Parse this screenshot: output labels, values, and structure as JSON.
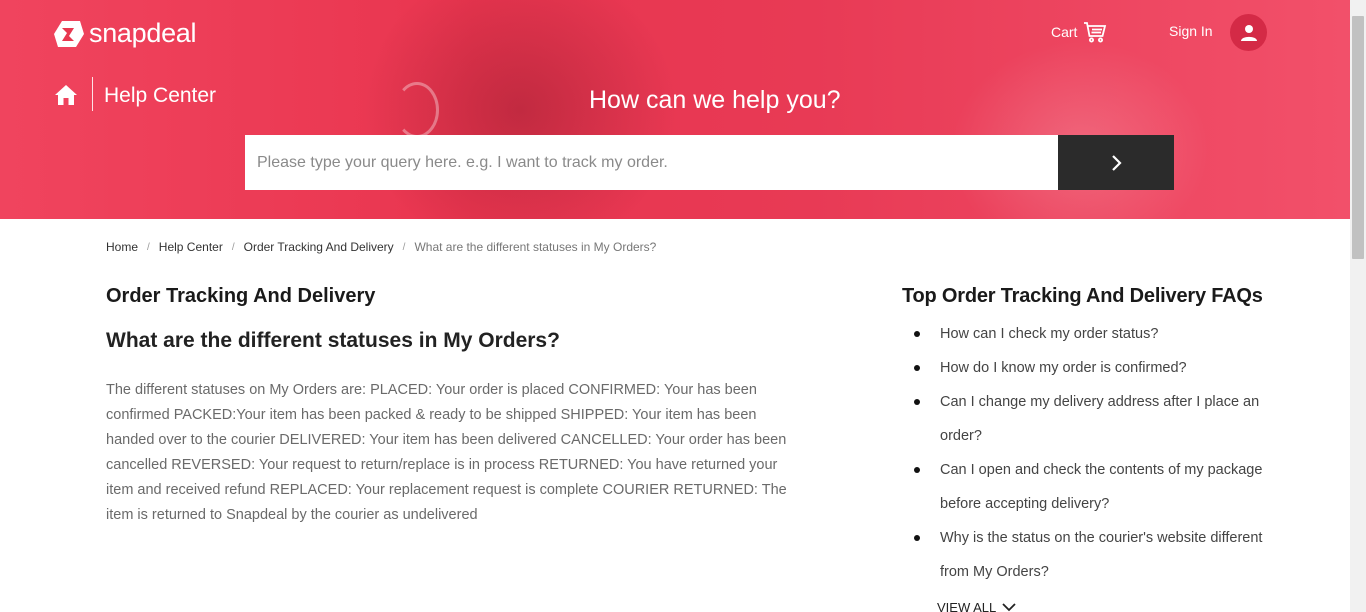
{
  "brand": {
    "name": "snapdeal"
  },
  "header": {
    "cart_label": "Cart",
    "signin_label": "Sign In",
    "help_center_title": "Help Center",
    "hero_heading": "How can we help you?"
  },
  "search": {
    "placeholder": "Please type your query here. e.g. I want to track my order."
  },
  "breadcrumb": {
    "items": [
      "Home",
      "Help Center",
      "Order Tracking And Delivery",
      "What are the different statuses in My Orders?"
    ]
  },
  "main": {
    "section_title": "Order Tracking And Delivery",
    "question_title": "What are the different statuses in My Orders?",
    "answer": "The different statuses on My Orders are: PLACED: Your order is placed CONFIRMED: Your has been confirmed PACKED:Your item has been packed & ready to be shipped SHIPPED: Your item has been handed over to the courier DELIVERED: Your item has been delivered CANCELLED: Your order has been cancelled REVERSED: Your request to return/replace is in process RETURNED: You have returned your item and received refund REPLACED: Your replacement request is complete COURIER RETURNED: The item is returned to Snapdeal by the courier as undelivered"
  },
  "sidebar": {
    "title": "Top Order Tracking And Delivery FAQs",
    "faqs": [
      "How can I check my order status?",
      "How do I know my order is confirmed?",
      "Can I change my delivery address after I place an order?",
      "Can I open and check the contents of my package before accepting delivery?",
      "Why is the status on the courier's website different from My Orders?"
    ],
    "view_all_label": "VIEW ALL"
  },
  "colors": {
    "brand_red": "#e8374f",
    "search_button": "#2b2b2b"
  },
  "icons": [
    "snapdeal-logo-icon",
    "cart-icon",
    "user-icon",
    "home-icon",
    "chevron-right-icon",
    "chevron-down-icon"
  ]
}
